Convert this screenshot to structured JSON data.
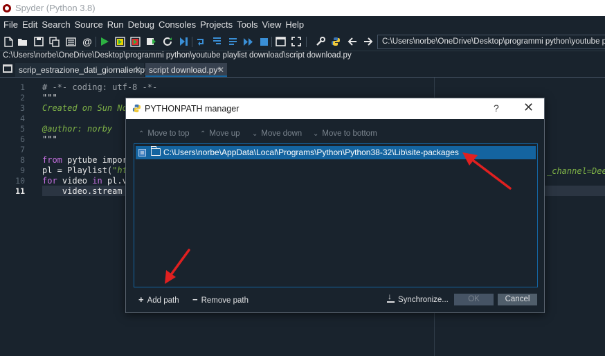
{
  "window": {
    "title": "Spyder (Python 3.8)"
  },
  "menu": [
    "File",
    "Edit",
    "Search",
    "Source",
    "Run",
    "Debug",
    "Consoles",
    "Projects",
    "Tools",
    "View",
    "Help"
  ],
  "toolbar": {
    "working_dir": "C:\\Users\\norbe\\OneDrive\\Desktop\\programmi python\\youtube playlist download"
  },
  "file_path": "C:\\Users\\norbe\\OneDrive\\Desktop\\programmi python\\youtube playlist download\\script download.py",
  "tabs": [
    {
      "label": "scrip_estrazione_dati_giornalieri.py"
    },
    {
      "label": "script download.py*"
    }
  ],
  "editor": {
    "line_numbers": [
      "1",
      "2",
      "3",
      "4",
      "5",
      "6",
      "7",
      "8",
      "9",
      "10",
      "11"
    ],
    "current_line": "11",
    "lines": {
      "l1": "# -*- coding: utf-8 -*-",
      "l2": "\"\"\"",
      "l3": "Created on Sun No",
      "l5": "@author: norby",
      "l6": "\"\"\"",
      "l8_kw": "from",
      "l8_rest": " pytube impor",
      "l9_a": "pl = Playlist(",
      "l9_str": "\"ht",
      "l10_kw": "for",
      "l10_rest": " video ",
      "l10_kw2": "in",
      "l10_rest2": " pl.v",
      "l11": "    video.stream"
    },
    "right_fragment": "_channel=Dee"
  },
  "dialog": {
    "title": "PYTHONPATH manager",
    "help_label": "?",
    "toolbar": {
      "move_top": "Move to top",
      "move_up": "Move up",
      "move_down": "Move down",
      "move_bottom": "Move to bottom"
    },
    "paths": [
      "C:\\Users\\norbe\\AppData\\Local\\Programs\\Python\\Python38-32\\Lib\\site-packages"
    ],
    "add_path": "Add path",
    "remove_path": "Remove path",
    "synchronize": "Synchronize...",
    "ok": "OK",
    "cancel": "Cancel"
  },
  "colors": {
    "annotation_arrow": "#e02020",
    "accent": "#1464a0"
  }
}
